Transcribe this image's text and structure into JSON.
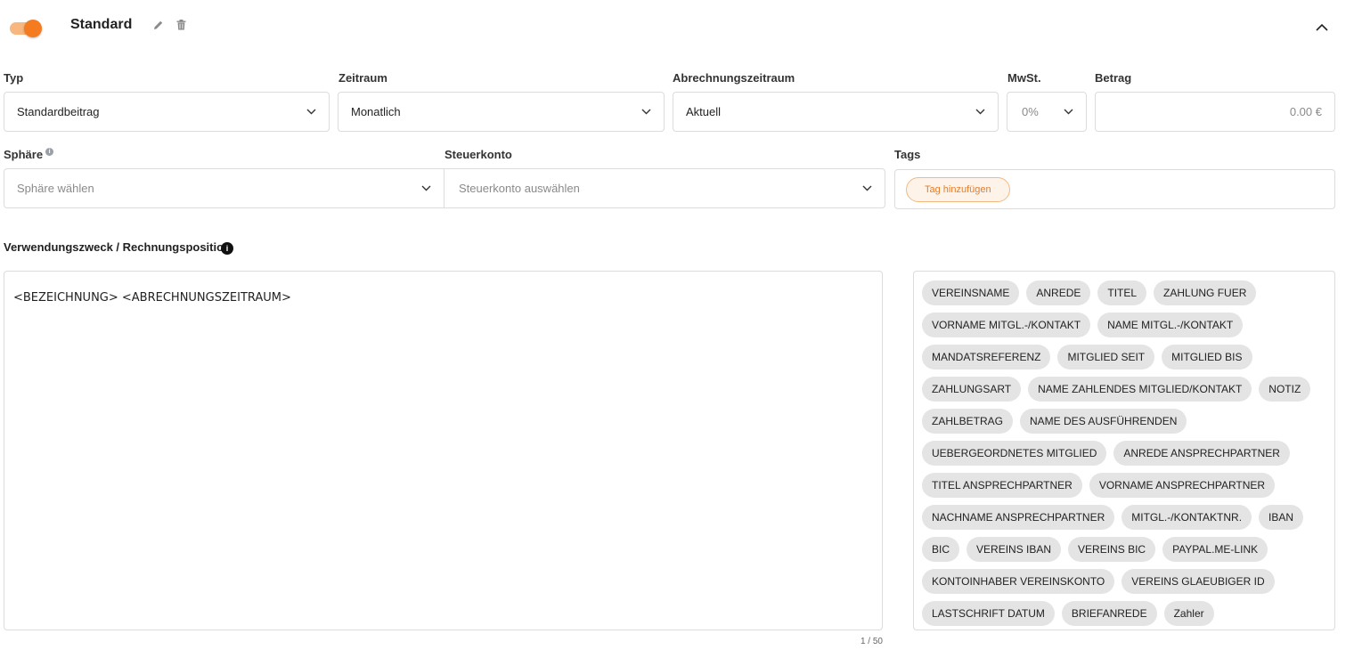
{
  "header": {
    "title": "Standard",
    "toggle_on": true,
    "accent": "#f47b20"
  },
  "fields": {
    "typ": {
      "label": "Typ",
      "value": "Standardbeitrag"
    },
    "zeitraum": {
      "label": "Zeitraum",
      "value": "Monatlich"
    },
    "abrechnungszeitraum": {
      "label": "Abrechnungszeitraum",
      "value": "Aktuell"
    },
    "mwst": {
      "label": "MwSt.",
      "value": "0%"
    },
    "betrag": {
      "label": "Betrag",
      "value": "0.00 €"
    },
    "sphaere": {
      "label": "Sphäre",
      "placeholder": "Sphäre wählen"
    },
    "steuerkonto": {
      "label": "Steuerkonto",
      "placeholder": "Steuerkonto auswählen"
    },
    "tags": {
      "label": "Tags",
      "add_label": "Tag hinzufügen"
    }
  },
  "verwendungszweck": {
    "label": "Verwendungszweck / Rechnungsposition",
    "text": "<BEZEICHNUNG> <ABRECHNUNGSZEITRAUM>",
    "counter": "1 / 50"
  },
  "placeholders": [
    "VEREINSNAME",
    "ANREDE",
    "TITEL",
    "ZAHLUNG FUER",
    "VORNAME MITGL.-/KONTAKT",
    "NAME MITGL.-/KONTAKT",
    "MANDATSREFERENZ",
    "MITGLIED SEIT",
    "MITGLIED BIS",
    "ZAHLUNGSART",
    "NAME ZAHLENDES MITGLIED/KONTAKT",
    "NOTIZ",
    "ZAHLBETRAG",
    "NAME DES AUSFÜHRENDEN",
    "UEBERGEORDNETES MITGLIED",
    "ANREDE ANSPRECHPARTNER",
    "TITEL ANSPRECHPARTNER",
    "VORNAME ANSPRECHPARTNER",
    "NACHNAME ANSPRECHPARTNER",
    "MITGL.-/KONTAKTNR.",
    "IBAN",
    "BIC",
    "VEREINS IBAN",
    "VEREINS BIC",
    "PAYPAL.ME-LINK",
    "KONTOINHABER VEREINSKONTO",
    "VEREINS GLAEUBIGER ID",
    "LASTSCHRIFT DATUM",
    "BRIEFANREDE",
    "Zahler"
  ]
}
